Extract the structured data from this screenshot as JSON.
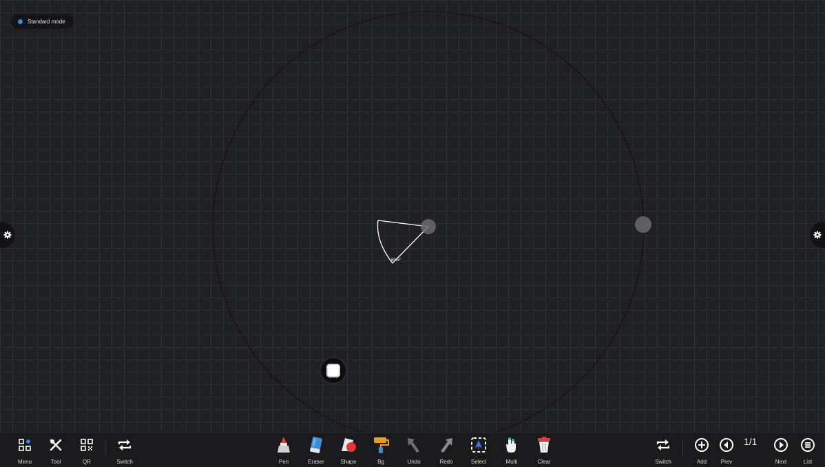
{
  "mode_indicator": {
    "label": "Standard mode",
    "dot_color": "#2f8fe4"
  },
  "protractor": {
    "angle_label": "60.5°"
  },
  "toolbar": {
    "left": [
      {
        "label": "Menu",
        "icon": "menu-grid-icon"
      },
      {
        "label": "Tool",
        "icon": "tools-icon"
      },
      {
        "label": "QR",
        "icon": "qr-code-icon"
      },
      {
        "label": "Switch",
        "icon": "switch-arrows-icon"
      }
    ],
    "center": [
      {
        "label": "Pen",
        "icon": "pen-icon"
      },
      {
        "label": "Eraser",
        "icon": "eraser-icon"
      },
      {
        "label": "Shape",
        "icon": "shape-icon"
      },
      {
        "label": "Bg",
        "icon": "paint-roller-icon"
      },
      {
        "label": "Undo",
        "icon": "undo-arrow-icon"
      },
      {
        "label": "Redo",
        "icon": "redo-arrow-icon"
      },
      {
        "label": "Select",
        "icon": "select-icon"
      },
      {
        "label": "Multi",
        "icon": "multi-touch-icon"
      },
      {
        "label": "Clear",
        "icon": "trash-icon"
      }
    ],
    "right": [
      {
        "label": "Switch",
        "icon": "switch-arrows-icon"
      },
      {
        "label": "Add",
        "icon": "add-page-icon"
      },
      {
        "label": "Prev",
        "icon": "prev-page-icon"
      },
      {
        "label": "Next",
        "icon": "next-page-icon"
      },
      {
        "label": "List",
        "icon": "page-list-icon"
      }
    ],
    "page_indicator": "1/1"
  },
  "colors": {
    "background": "#1f2023",
    "grid": "#2b2c30",
    "toolbar": "#1a1a1d",
    "accent_blue": "#2f8fe4",
    "eraser_blue": "#3a8fd6",
    "shape_red": "#e8323c",
    "roller_orange": "#f19a1c",
    "clear_red": "#e0383e"
  }
}
